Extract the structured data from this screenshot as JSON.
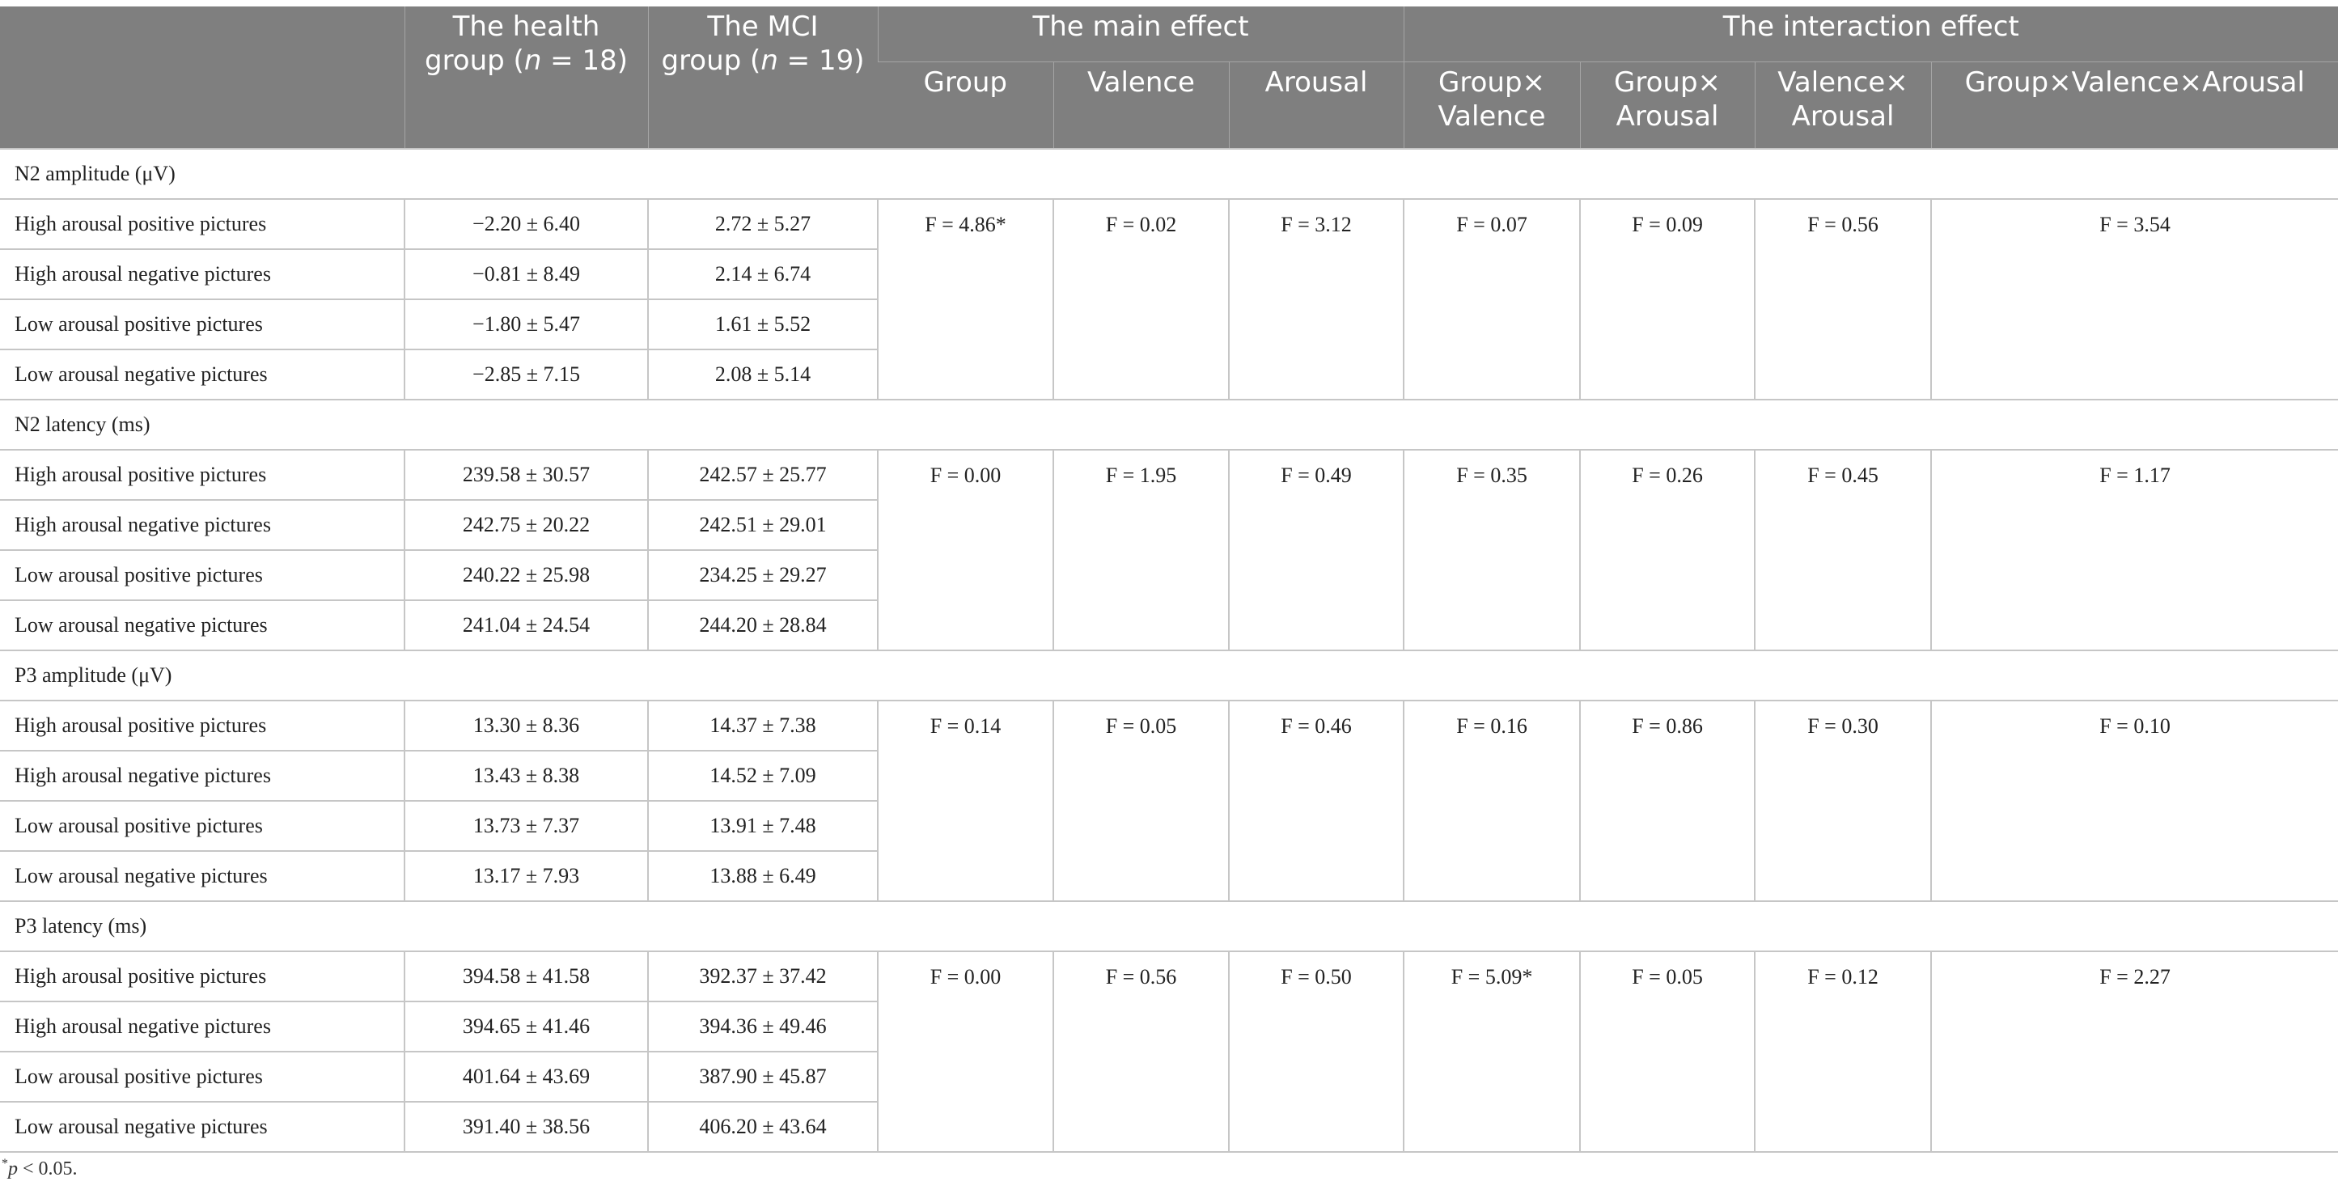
{
  "header": {
    "health_group": [
      "The health",
      "group ("
    ],
    "mci_group": [
      "The MCI",
      "group ("
    ],
    "n_symbol": "n",
    "health_n": " = 18)",
    "mci_n": " = 19)",
    "main_effect": "The main effect",
    "interaction_effect": "The interaction effect",
    "group": "Group",
    "valence": "Valence",
    "arousal": "Arousal",
    "group_valence": [
      "Group×",
      "Valence"
    ],
    "group_arousal": [
      "Group×",
      "Arousal"
    ],
    "valence_arousal": [
      "Valence×",
      "Arousal"
    ],
    "group_valence_arousal": "Group×Valence×Arousal"
  },
  "sections": [
    {
      "title": "N2 amplitude (μV)",
      "rows": [
        {
          "label": "High arousal positive pictures",
          "health": "−2.20 ± 6.40",
          "mci": "2.72 ± 5.27"
        },
        {
          "label": "High arousal negative pictures",
          "health": "−0.81 ± 8.49",
          "mci": "2.14 ± 6.74"
        },
        {
          "label": "Low arousal positive pictures",
          "health": "−1.80 ± 5.47",
          "mci": "1.61 ± 5.52"
        },
        {
          "label": "Low arousal negative pictures",
          "health": "−2.85 ± 7.15",
          "mci": "2.08 ± 5.14"
        }
      ],
      "stats": {
        "group": "F = 4.86*",
        "valence": "F = 0.02",
        "arousal": "F = 3.12",
        "group_valence": "F = 0.07",
        "group_arousal": "F = 0.09",
        "valence_arousal": "F = 0.56",
        "group_valence_arousal": "F = 3.54"
      }
    },
    {
      "title": "N2 latency (ms)",
      "rows": [
        {
          "label": "High arousal positive pictures",
          "health": "239.58 ± 30.57",
          "mci": "242.57 ± 25.77"
        },
        {
          "label": "High arousal negative pictures",
          "health": "242.75 ± 20.22",
          "mci": "242.51 ± 29.01"
        },
        {
          "label": "Low arousal positive pictures",
          "health": "240.22 ± 25.98",
          "mci": "234.25 ± 29.27"
        },
        {
          "label": "Low arousal negative pictures",
          "health": "241.04 ± 24.54",
          "mci": "244.20 ± 28.84"
        }
      ],
      "stats": {
        "group": "F = 0.00",
        "valence": "F = 1.95",
        "arousal": "F = 0.49",
        "group_valence": "F = 0.35",
        "group_arousal": "F = 0.26",
        "valence_arousal": "F = 0.45",
        "group_valence_arousal": "F = 1.17"
      }
    },
    {
      "title": "P3 amplitude (μV)",
      "rows": [
        {
          "label": "High arousal positive pictures",
          "health": "13.30 ± 8.36",
          "mci": "14.37 ± 7.38"
        },
        {
          "label": "High arousal negative pictures",
          "health": "13.43 ± 8.38",
          "mci": "14.52 ± 7.09"
        },
        {
          "label": "Low arousal positive pictures",
          "health": "13.73 ± 7.37",
          "mci": "13.91 ± 7.48"
        },
        {
          "label": "Low arousal negative pictures",
          "health": "13.17 ± 7.93",
          "mci": "13.88 ± 6.49"
        }
      ],
      "stats": {
        "group": "F = 0.14",
        "valence": "F = 0.05",
        "arousal": "F = 0.46",
        "group_valence": "F = 0.16",
        "group_arousal": "F = 0.86",
        "valence_arousal": "F = 0.30",
        "group_valence_arousal": "F = 0.10"
      }
    },
    {
      "title": "P3 latency (ms)",
      "rows": [
        {
          "label": "High arousal positive pictures",
          "health": "394.58 ± 41.58",
          "mci": "392.37 ± 37.42"
        },
        {
          "label": "High arousal negative pictures",
          "health": "394.65 ± 41.46",
          "mci": "394.36 ± 49.46"
        },
        {
          "label": "Low arousal positive pictures",
          "health": "401.64 ± 43.69",
          "mci": "387.90 ± 45.87"
        },
        {
          "label": "Low arousal negative pictures",
          "health": "391.40 ± 38.56",
          "mci": "406.20 ± 43.64"
        }
      ],
      "stats": {
        "group": "F = 0.00",
        "valence": "F = 0.56",
        "arousal": "F = 0.50",
        "group_valence": "F = 5.09*",
        "group_arousal": "F = 0.05",
        "valence_arousal": "F = 0.12",
        "group_valence_arousal": "F = 2.27"
      }
    }
  ],
  "footnote": {
    "marker": "*",
    "p_symbol": "p",
    "text": " < 0.05."
  },
  "colors": {
    "header_bg": "#7f7f7f",
    "header_text": "#ffffff",
    "rule": "#c6c6c6"
  }
}
